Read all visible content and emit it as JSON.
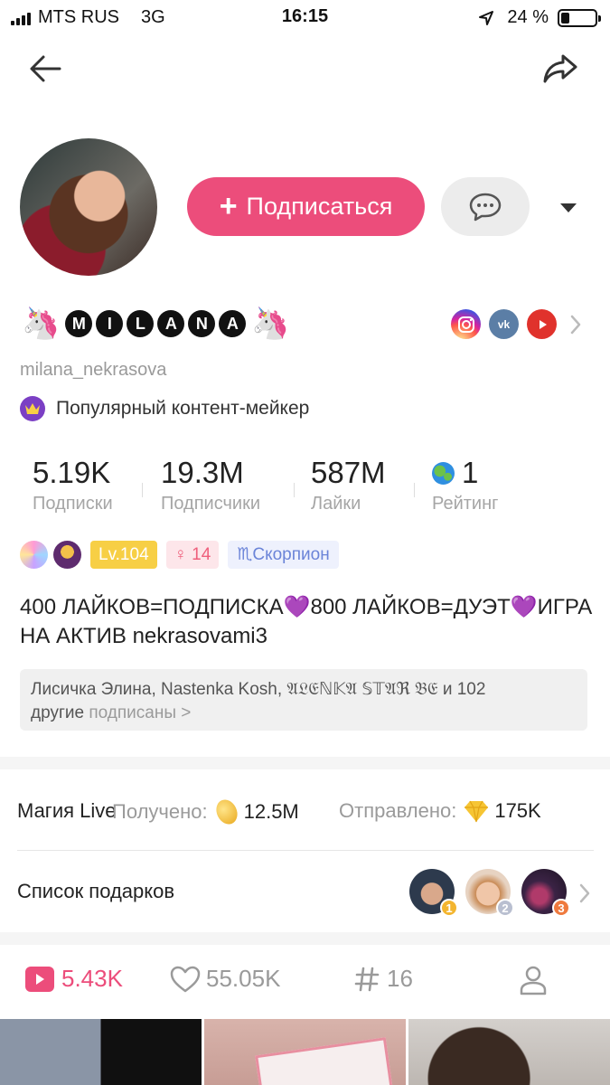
{
  "status_bar": {
    "carrier": "MTS RUS",
    "network": "3G",
    "time": "16:15",
    "battery": "24 %",
    "battery_level": 0.24
  },
  "nav": {
    "back_icon": "arrow-left-icon",
    "share_icon": "share-arrow-icon"
  },
  "profile": {
    "name_prefix_emoji": "🦄",
    "name_letters": [
      "M",
      "I",
      "L",
      "A",
      "N",
      "A"
    ],
    "name_suffix_emoji": "🦄",
    "follow_plus": "+",
    "follow_label": "Подписаться",
    "username": "milana_nekrasova",
    "creator_label": "Популярный контент-мейкер",
    "socials": [
      "instagram",
      "vk",
      "youtube"
    ],
    "social_vk_text": "vk"
  },
  "stats": [
    {
      "value": "5.19K",
      "label": "Подписки"
    },
    {
      "value": "19.3M",
      "label": "Подписчики"
    },
    {
      "value": "587M",
      "label": "Лайки"
    },
    {
      "value": "1",
      "label": "Рейтинг"
    }
  ],
  "badges": {
    "level": "Lv.104",
    "gender_age": "♀ 14",
    "zodiac": "♏Скорпион"
  },
  "bio": "400 ЛАЙКОВ=ПОДПИСКА💜800 ЛАЙКОВ=ДУЭТ💜ИГРА НА АКТИВ nekrasovami3",
  "followed_by": {
    "names": "Лисичка Элина, Nastenka Kosh, 𝔄𝔏𝔈ℕ𝕂𝔄 𝕊𝕋𝔄ℜ 𝔅𝔈 и 102",
    "others": "другие",
    "suffix": "подписаны >"
  },
  "magic_live": {
    "title": "Магия Live",
    "received_label": "Получено:",
    "received_value": "12.5M",
    "sent_label": "Отправлено:",
    "sent_value": "175K"
  },
  "gifts": {
    "title": "Список подарков",
    "ranks": [
      "1",
      "2",
      "3"
    ]
  },
  "tabs": {
    "videos": "5.43K",
    "likes": "55.05K",
    "hashtags": "16"
  },
  "colors": {
    "accent": "#ec4d7b",
    "muted": "#9a9a9a",
    "level_badge": "#f7cf45"
  }
}
